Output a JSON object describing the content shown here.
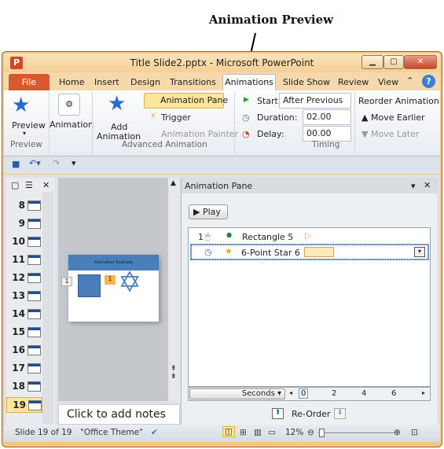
{
  "caption": "Animation Preview",
  "window": {
    "title": "Title Slide2.pptx  -  Microsoft PowerPoint",
    "app_icon": "P"
  },
  "tabs": [
    "File",
    "Home",
    "Insert",
    "Design",
    "Transitions",
    "Animations",
    "Slide Show",
    "Review",
    "View"
  ],
  "ribbon": {
    "preview": {
      "label": "Preview",
      "group": "Preview"
    },
    "animation": {
      "label": "Animation"
    },
    "add_animation": {
      "label1": "Add",
      "label2": "Animation"
    },
    "animation_pane": "Animation Pane",
    "trigger": "Trigger",
    "animation_painter": "Animation Painter",
    "advanced_group": "Advanced Animation",
    "start_label": "Start:",
    "start_value": "After Previous",
    "duration_label": "Duration:",
    "duration_value": "02.00",
    "delay_label": "Delay:",
    "delay_value": "00.00",
    "timing_group": "Timing",
    "reorder_title": "Reorder Animation",
    "move_earlier": "Move Earlier",
    "move_later": "Move Later"
  },
  "slides": [
    "8",
    "9",
    "10",
    "11",
    "12",
    "13",
    "14",
    "15",
    "16",
    "17",
    "18",
    "19"
  ],
  "selected_slide": "19",
  "slide_preview": {
    "title": "Animation Example",
    "tag1": "1",
    "tag2": "1"
  },
  "notes_placeholder": "Click to add notes",
  "pane": {
    "title": "Animation Pane",
    "play": "Play",
    "items": [
      {
        "order": "1",
        "name": "Rectangle 5"
      },
      {
        "order": "",
        "name": "6-Point Star 6"
      }
    ],
    "seconds": "Seconds",
    "ticks": [
      "0",
      "2",
      "4",
      "6"
    ],
    "reorder": "Re-Order"
  },
  "status": {
    "slide": "Slide 19 of 19",
    "theme": "\"Office Theme\"",
    "zoom": "12%",
    "zoom_percent": 12
  },
  "colors": {
    "accent": "#f5d9ac",
    "file_tab": "#d65a2e",
    "shape": "#4a7ebb"
  }
}
